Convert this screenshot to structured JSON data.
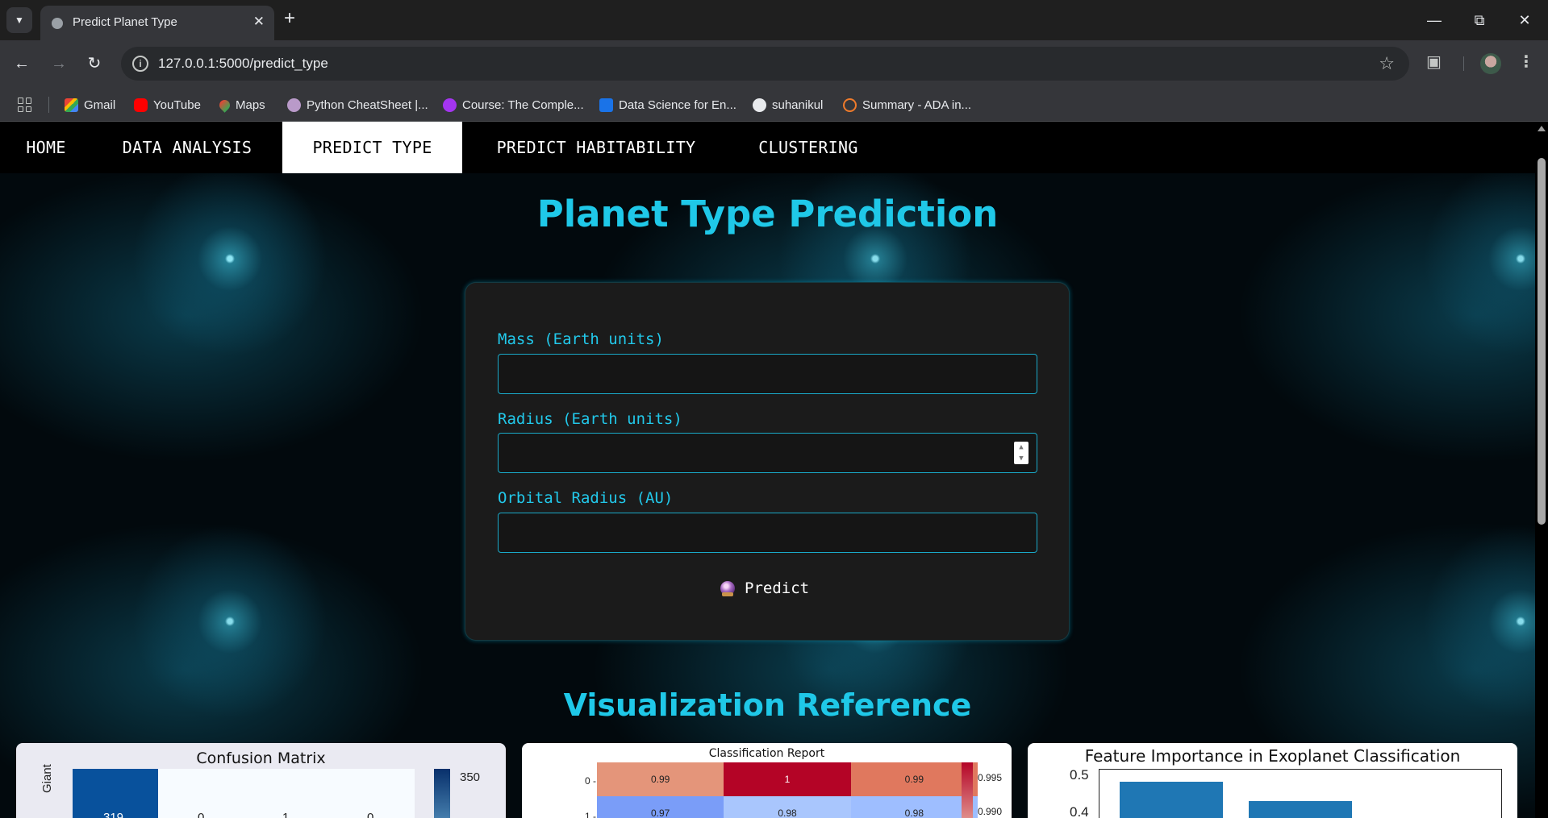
{
  "browser": {
    "tab_title": "Predict Planet Type",
    "url": "127.0.0.1:5000/predict_type",
    "bookmarks": [
      "Gmail",
      "YouTube",
      "Maps",
      "Python CheatSheet |...",
      "Course: The Comple...",
      "Data Science for En...",
      "suhanikul",
      "Summary - ADA in..."
    ]
  },
  "nav": {
    "items": [
      "HOME",
      "DATA ANALYSIS",
      "PREDICT TYPE",
      "PREDICT HABITABILITY",
      "CLUSTERING"
    ],
    "active": "PREDICT TYPE"
  },
  "page": {
    "title": "Planet Type Prediction",
    "form": {
      "mass_label": "Mass (Earth units)",
      "mass_value": "",
      "radius_label": "Radius (Earth units)",
      "radius_value": "",
      "orbital_label": "Orbital Radius (AU)",
      "orbital_value": "",
      "predict_label": "Predict"
    },
    "visualization_title": "Visualization Reference"
  },
  "visualizations": {
    "confusion_matrix": {
      "title": "Confusion Matrix",
      "row_label": "Giant",
      "first_row_values": [
        "319",
        "0",
        "1",
        "0"
      ],
      "colorbar_tick": "350"
    },
    "classification_report": {
      "title": "Classification Report",
      "row_labels": [
        "0 -",
        "1 -"
      ],
      "rows": [
        [
          "0.99",
          "1",
          "0.99"
        ],
        [
          "0.97",
          "0.98",
          "0.98"
        ]
      ],
      "colorbar_ticks": [
        "0.995",
        "0.990"
      ]
    },
    "feature_importance": {
      "title": "Feature Importance in Exoplanet Classification",
      "y_ticks": [
        "0.5",
        "0.4"
      ]
    }
  },
  "colors": {
    "accent": "#1fc8e8",
    "card_bg": "#1b1b1b",
    "nav_bg": "#000000",
    "heat_high": "#b40426",
    "heat_mid": "#e4957a",
    "heat_low": "#8fb1f3",
    "bar_blue": "#1f77b4"
  }
}
